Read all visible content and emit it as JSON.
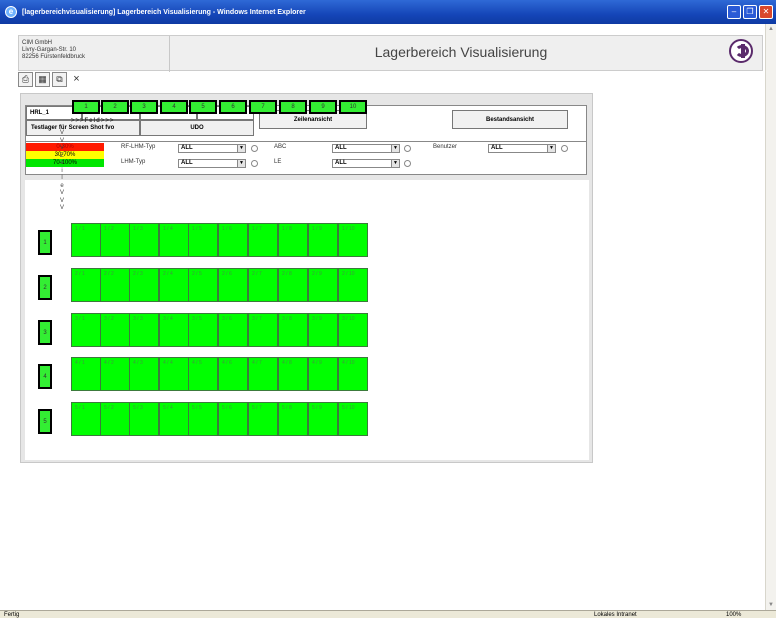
{
  "window": {
    "title": "[lagerbereichvisualisierung] Lagerbereich Visualisierung - Windows Internet Explorer"
  },
  "header": {
    "company_lines": [
      "CIM GmbH",
      "Livry-Gargan-Str. 10",
      "82256 Fürstenfeldbruck"
    ],
    "app_title": "Lagerbereich Visualisierung"
  },
  "toolbar": {
    "icons": [
      "print-icon",
      "document-icon",
      "copy-icon",
      "close-icon"
    ],
    "close_glyph": "×"
  },
  "control": {
    "hrl": "HRL_1",
    "lager_button": "Testlager für Screen Shot fvo",
    "udo_button": "UDO",
    "zeilen_button": "Zeilenansicht",
    "bestand_button": "Bestandsansicht",
    "legend": [
      "0-30%",
      "30-70%",
      "70-100%"
    ],
    "filters": {
      "rf_lhm_typ": {
        "label": "RF-LHM-Typ",
        "value": "ALL"
      },
      "lhm_typ": {
        "label": "LHM-Typ",
        "value": "ALL"
      },
      "abc": {
        "label": "ABC",
        "value": "ALL"
      },
      "le": {
        "label": "LE",
        "value": "ALL"
      },
      "benutzer": {
        "label": "Benutzer",
        "value": "ALL"
      }
    }
  },
  "grid": {
    "feld_label": ">>>Feld>>>",
    "zeile_label": [
      "V",
      "V",
      "V",
      "Z",
      "e",
      "i",
      "l",
      "e",
      "V",
      "V",
      "V"
    ],
    "columns": [
      "1",
      "2",
      "3",
      "4",
      "5",
      "6",
      "7",
      "8",
      "9",
      "10"
    ],
    "rows": [
      {
        "label": "1",
        "slots": [
          "1 / 1",
          "1 / 2",
          "1 / 3",
          "1 / 4",
          "1 / 5",
          "1 / 6",
          "1 / 7",
          "1 / 8",
          "1 / 9",
          "1 / 10"
        ]
      },
      {
        "label": "2",
        "slots": [
          "2 / 1",
          "2 / 2",
          "2 / 3",
          "2 / 4",
          "2 / 5",
          "2 / 6",
          "2 / 7",
          "2 / 8",
          "2 / 9",
          "2 / 10"
        ]
      },
      {
        "label": "3",
        "slots": [
          "3 / 1",
          "3 / 2",
          "3 / 3",
          "3 / 4",
          "3 / 5",
          "3 / 6",
          "3 / 7",
          "3 / 8",
          "3 / 9",
          "3 / 10"
        ]
      },
      {
        "label": "4",
        "slots": [
          "4 / 1",
          "4 / 2",
          "4 / 3",
          "4 / 4",
          "4 / 5",
          "4 / 6",
          "4 / 7",
          "4 / 8",
          "4 / 9",
          "4 / 10"
        ]
      },
      {
        "label": "5",
        "slots": [
          "5 / 1",
          "5 / 2",
          "5 / 3",
          "5 / 4",
          "5 / 5",
          "5 / 6",
          "5 / 7",
          "5 / 8",
          "5 / 9",
          "5 / 10"
        ]
      }
    ]
  },
  "statusbar": {
    "ready": "Fertig",
    "zone": "Lokales Intranet",
    "zoom": "100%"
  },
  "colors": {
    "slot": "#00ff00",
    "low": "#ff1a00",
    "mid": "#ffff00",
    "high": "#00e600",
    "titlebar": "#1546b8"
  }
}
